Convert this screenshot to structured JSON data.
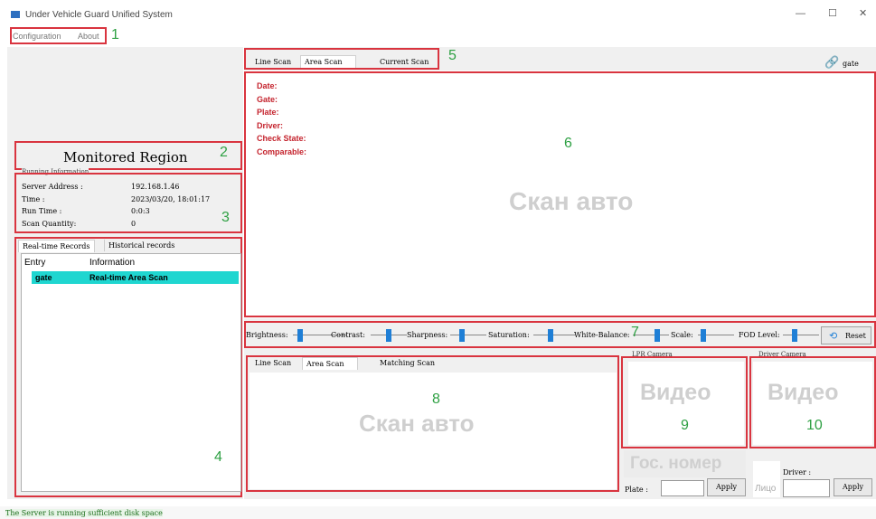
{
  "window": {
    "title": "Under Vehicle Guard Unified System",
    "minimize": "—",
    "maximize": "☐",
    "close": "✕"
  },
  "menu": {
    "configuration": "Configuration",
    "about": "About"
  },
  "region_numbers": [
    "1",
    "2",
    "3",
    "4",
    "5",
    "6",
    "7",
    "8",
    "9",
    "10"
  ],
  "monitored_region": "Monitored Region",
  "running_info": {
    "title": "Running Information",
    "server_address_label": "Server Address :",
    "server_address_value": "192.168.1.46",
    "time_label": "Time :",
    "time_value": "2023/03/20, 18:01:17",
    "run_time_label": "Run Time :",
    "run_time_value": "0:0:3",
    "scan_quantity_label": "Scan Quantity:",
    "scan_quantity_value": "0"
  },
  "records": {
    "tabs": [
      "Real-time Records",
      "Historical records"
    ],
    "columns": [
      "Entry",
      "Information"
    ],
    "rows": [
      {
        "entry": "gate",
        "information": "Real-time Area Scan"
      }
    ]
  },
  "scan_tabs": [
    "Line Scan",
    "Area Scan",
    "Current Scan"
  ],
  "gate_label": "gate",
  "vehicle_info": [
    "Date:",
    "Gate:",
    "Plate:",
    "Driver:",
    "Check State:",
    "Comparable:"
  ],
  "watermarks": {
    "scan_auto": "Скан авто",
    "video": "Видео",
    "plate_number": "Гос. номер",
    "face": "Лицо"
  },
  "controls": {
    "labels": [
      "Brightness:",
      "Contrast:",
      "Sharpness:",
      "Saturation:",
      "White-Balance:",
      "Scale:",
      "FOD Level:"
    ],
    "levels": [
      0.1,
      0.5,
      0.3,
      0.4,
      0.7,
      0.1,
      0.3
    ],
    "reset": "Reset"
  },
  "bottom_tabs": [
    "Line Scan",
    "Area Scan",
    "Matching Scan"
  ],
  "lpr_camera": "LPR Camera",
  "driver_camera": "Driver Camera",
  "plate_label": "Plate :",
  "driver_label": "Driver :",
  "apply": "Apply",
  "status": "The Server is running sufficient disk space",
  "colors": {
    "highlight": "#1fd6d0",
    "accent": "#1f7fd6",
    "box": "#d9343f",
    "num": "#2ea043",
    "info_text": "#c4222c"
  }
}
